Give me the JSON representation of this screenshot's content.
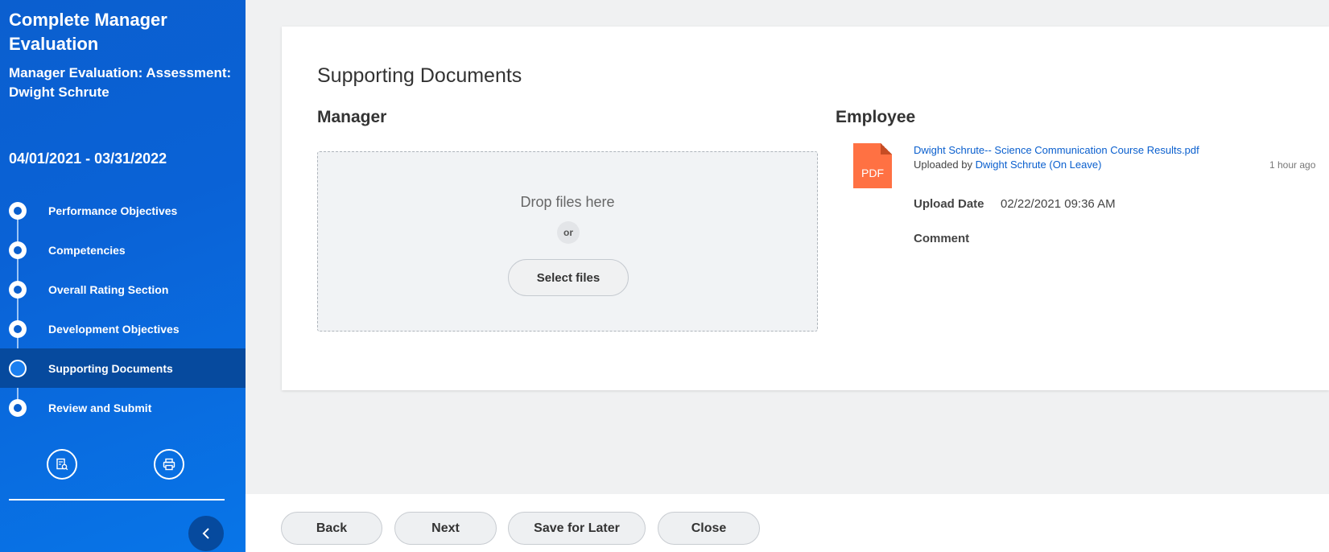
{
  "sidebar": {
    "title": "Complete Manager Evaluation",
    "subtitle": "Manager Evaluation: Assessment: Dwight Schrute",
    "dates": "04/01/2021 - 03/31/2022",
    "steps": [
      {
        "label": "Performance Objectives"
      },
      {
        "label": "Competencies"
      },
      {
        "label": "Overall Rating Section"
      },
      {
        "label": "Development Objectives"
      },
      {
        "label": "Supporting Documents",
        "active": true
      },
      {
        "label": "Review and Submit"
      }
    ],
    "icons": {
      "left": "document-search-icon",
      "right": "print-icon",
      "collapse": "chevron-left-icon"
    }
  },
  "main": {
    "title": "Supporting Documents",
    "manager": {
      "heading": "Manager",
      "drop_text": "Drop files here",
      "or_text": "or",
      "select_button": "Select files"
    },
    "employee": {
      "heading": "Employee",
      "file": {
        "icon_label": "PDF",
        "name": "Dwight Schrute-- Science Communication Course Results.pdf",
        "uploaded_by_prefix": "Uploaded by",
        "uploaded_by": "Dwight Schrute (On Leave)",
        "time_ago": "1 hour ago",
        "upload_date_label": "Upload Date",
        "upload_date": "02/22/2021 09:36 AM",
        "comment_label": "Comment"
      }
    }
  },
  "footer": {
    "back": "Back",
    "next": "Next",
    "save_for_later": "Save for Later",
    "close": "Close"
  },
  "colors": {
    "sidebar_blue": "#0a62d6",
    "active_step": "#064a9e",
    "link_blue": "#0a5fce",
    "pdf_orange": "#ff7143"
  }
}
